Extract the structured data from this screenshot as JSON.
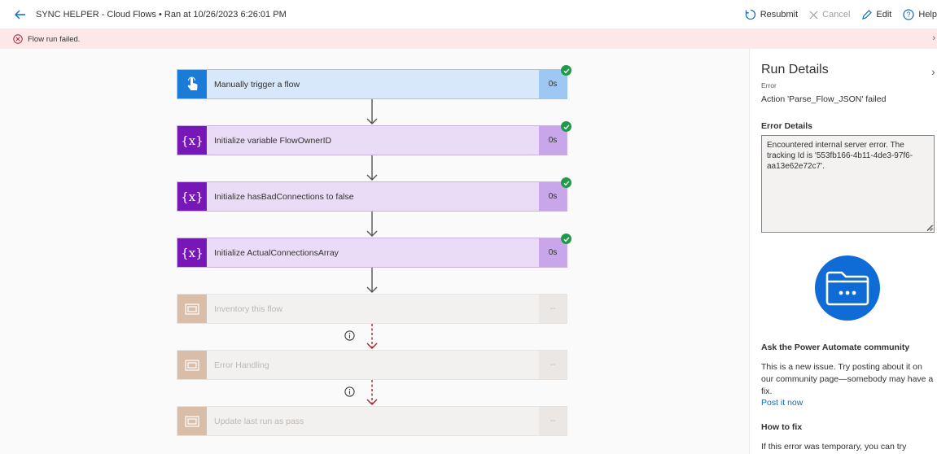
{
  "header": {
    "title": "SYNC HELPER - Cloud Flows • Ran at 10/26/2023 6:26:01 PM",
    "actions": {
      "resubmit": "Resubmit",
      "cancel": "Cancel",
      "edit": "Edit",
      "help": "Help"
    }
  },
  "error_bar": {
    "message": "Flow run failed."
  },
  "flow": {
    "steps": [
      {
        "label": "Manually trigger a flow",
        "duration": "0s",
        "status": "succeeded",
        "icon": "touch-icon"
      },
      {
        "label": "Initialize variable FlowOwnerID",
        "duration": "0s",
        "status": "succeeded",
        "icon": "variable-icon"
      },
      {
        "label": "Initialize hasBadConnections to false",
        "duration": "0s",
        "status": "succeeded",
        "icon": "variable-icon"
      },
      {
        "label": "Initialize ActualConnectionsArray",
        "duration": "0s",
        "status": "succeeded",
        "icon": "variable-icon"
      },
      {
        "label": "Inventory this flow",
        "duration": "--",
        "status": "skipped",
        "icon": "scope-icon"
      },
      {
        "label": "Error Handling",
        "duration": "--",
        "status": "skipped",
        "icon": "scope-icon"
      },
      {
        "label": "Update last run as pass",
        "duration": "--",
        "status": "skipped",
        "icon": "scope-icon"
      }
    ]
  },
  "panel": {
    "title": "Run Details",
    "status_label": "Error",
    "status_message": "Action 'Parse_Flow_JSON' failed",
    "error_details_heading": "Error Details",
    "error_details_text": "Encountered internal server error. The tracking Id is '553fb166-4b11-4de3-97f6-aa13e62e72c7'.",
    "community_heading": "Ask the Power Automate community",
    "community_text": "This is a new issue. Try posting about it on our community page—somebody may have a fix.",
    "post_link": "Post it now",
    "howto_heading": "How to fix",
    "howto_text": "If this error was temporary, you can try"
  },
  "colors": {
    "trigger_blue": "#1b7cd8",
    "variable_purple": "#7717b8",
    "success_green": "#1f9a4a",
    "error_bg": "#fde7e9",
    "error_red": "#a4262c",
    "link_blue": "#0f6cbd"
  }
}
